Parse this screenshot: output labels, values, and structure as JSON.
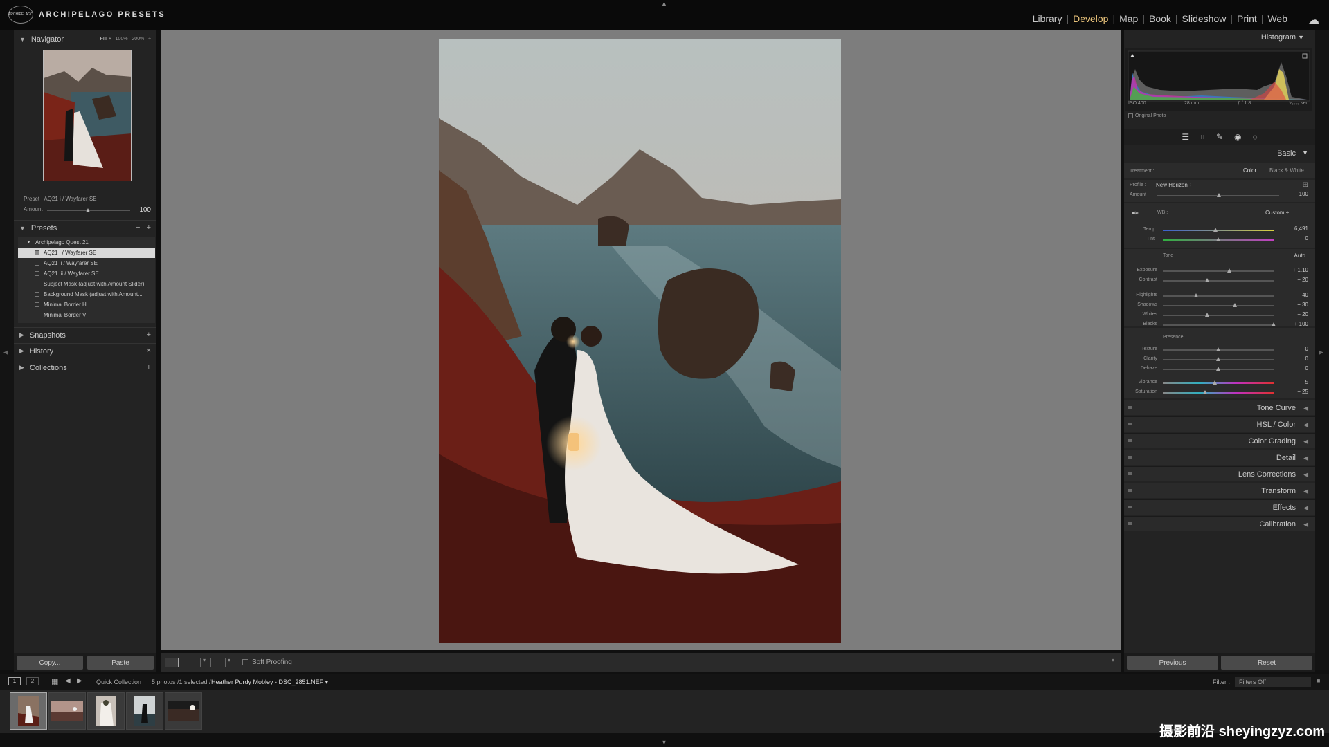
{
  "brand": {
    "name": "ARCHIPELAGO PRESETS",
    "badge": "ARCHIPELAGO"
  },
  "modules": {
    "items": [
      "Library",
      "Develop",
      "Map",
      "Book",
      "Slideshow",
      "Print",
      "Web"
    ],
    "active": "Develop"
  },
  "navigator": {
    "title": "Navigator",
    "zoom": [
      "FIT ÷",
      "100%",
      "200%",
      "÷"
    ]
  },
  "preset_info": {
    "label": "Preset : AQ21 i / Wayfarer SE",
    "amount_label": "Amount",
    "amount_value": "100",
    "amount_fraction": 0.5
  },
  "presets": {
    "title": "Presets",
    "folder": "Archipelago Quest 21",
    "items": [
      "AQ21 i / Wayfarer SE",
      "AQ21 ii / Wayfarer SE",
      "AQ21 iii / Wayfarer SE",
      "Subject Mask (adjust with Amount Slider)",
      "Background Mask (adjust with Amount...",
      "Minimal Border H",
      "Minimal Border V"
    ],
    "selected_index": 0
  },
  "left_sections": {
    "snapshots": "Snapshots",
    "history": "History",
    "collections": "Collections"
  },
  "left_buttons": {
    "copy": "Copy...",
    "paste": "Paste"
  },
  "toolbar": {
    "soft_proofing": "Soft Proofing"
  },
  "histogram": {
    "title": "Histogram",
    "iso": "ISO 400",
    "focal": "28 mm",
    "aperture": "ƒ / 1.8",
    "shutter": "¹⁄₁₀₀₀ sec",
    "original_photo": "Original Photo"
  },
  "basic": {
    "title": "Basic",
    "treatment_label": "Treatment :",
    "treatment_color": "Color",
    "treatment_bw": "Black & White",
    "profile_label": "Profile :",
    "profile_value": "New Horizon ÷",
    "amount_label": "Amount",
    "amount_value": "100",
    "wb_label": "WB :",
    "wb_value": "Custom ÷",
    "temp_label": "Temp",
    "temp_value": "6,491",
    "tint_label": "Tint",
    "tint_value": "0",
    "tone_label": "Tone",
    "auto_label": "Auto",
    "presence_label": "Presence",
    "sliders": [
      {
        "label": "Exposure",
        "value": "+ 1.10",
        "pos": 0.6
      },
      {
        "label": "Contrast",
        "value": "− 20",
        "pos": 0.4
      },
      {
        "label": "Highlights",
        "value": "− 40",
        "pos": 0.3
      },
      {
        "label": "Shadows",
        "value": "+ 30",
        "pos": 0.65
      },
      {
        "label": "Whites",
        "value": "− 20",
        "pos": 0.4
      },
      {
        "label": "Blacks",
        "value": "+ 100",
        "pos": 1.0
      },
      {
        "label": "Texture",
        "value": "0",
        "pos": 0.5
      },
      {
        "label": "Clarity",
        "value": "0",
        "pos": 0.5
      },
      {
        "label": "Dehaze",
        "value": "0",
        "pos": 0.5
      },
      {
        "label": "Vibrance",
        "value": "− 5",
        "pos": 0.47
      },
      {
        "label": "Saturation",
        "value": "− 25",
        "pos": 0.38
      }
    ]
  },
  "collapsed_panels": [
    "Tone Curve",
    "HSL / Color",
    "Color Grading",
    "Detail",
    "Lens Corrections",
    "Transform",
    "Effects",
    "Calibration"
  ],
  "right_buttons": {
    "previous": "Previous",
    "reset": "Reset"
  },
  "filmbar": {
    "page1": "1",
    "page2": "2",
    "source": "Quick Collection",
    "info": "5 photos /1 selected /",
    "filename": "Heather Purdy Mobley - DSC_2851.NEF ▾",
    "filter_label": "Filter :",
    "filter_value": "Filters Off"
  },
  "watermark": "摄影前沿 sheyingzyz.com"
}
